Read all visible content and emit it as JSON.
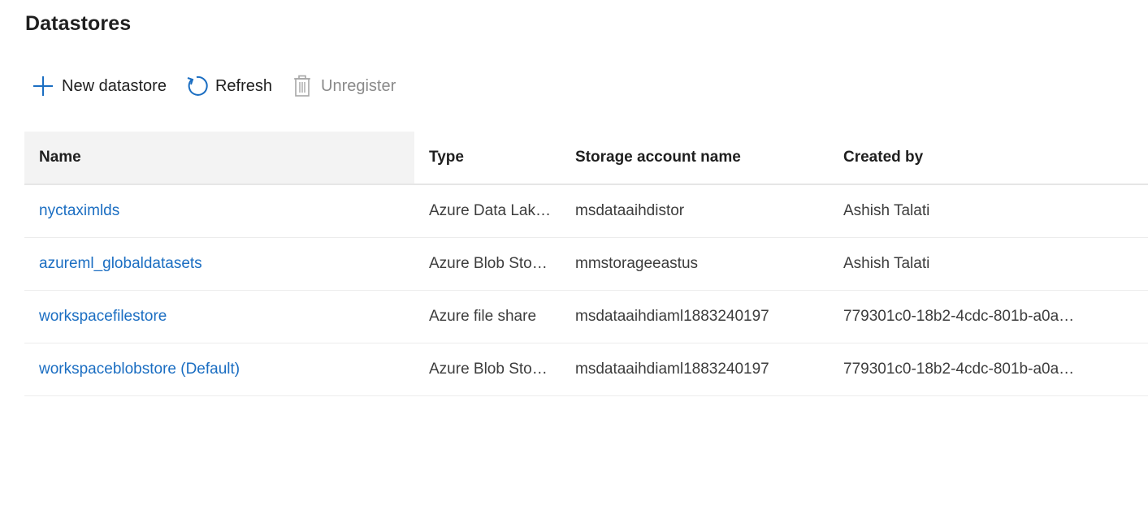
{
  "page": {
    "title": "Datastores"
  },
  "toolbar": {
    "new_label": "New datastore",
    "new_icon": "plus-icon",
    "refresh_label": "Refresh",
    "refresh_icon": "refresh-icon",
    "unregister_label": "Unregister",
    "unregister_icon": "trash-icon",
    "accent_color": "#1b6ec2",
    "disabled_color": "#a6a6a6"
  },
  "table": {
    "columns": [
      "Name",
      "Type",
      "Storage account name",
      "Created by"
    ],
    "rows": [
      {
        "name": "nyctaximlds",
        "type": "Azure Data Lak…",
        "storage": "msdataaihdistor",
        "created_by": "Ashish Talati"
      },
      {
        "name": "azureml_globaldatasets",
        "type": "Azure Blob Sto…",
        "storage": "mmstorageeastus",
        "created_by": "Ashish Talati"
      },
      {
        "name": "workspacefilestore",
        "type": "Azure file share",
        "storage": "msdataaihdiaml1883240197",
        "created_by": "779301c0-18b2-4cdc-801b-a0a…"
      },
      {
        "name": "workspaceblobstore (Default)",
        "type": "Azure Blob Sto…",
        "storage": "msdataaihdiaml1883240197",
        "created_by": "779301c0-18b2-4cdc-801b-a0a…"
      }
    ]
  }
}
